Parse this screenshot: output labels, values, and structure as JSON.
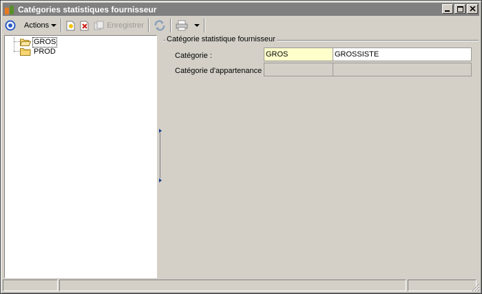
{
  "window": {
    "title": "Catégories statistiques fournisseur"
  },
  "toolbar": {
    "actions_label": "Actions",
    "save_label": "Enregistrer"
  },
  "tree": {
    "items": [
      {
        "label": "GROS",
        "selected": true,
        "open": true
      },
      {
        "label": "PROD",
        "selected": false,
        "open": false
      }
    ]
  },
  "form": {
    "group_title": "Catégorie statistique fournisseur",
    "categorie_label": "Catégorie :",
    "categorie_code": "GROS",
    "categorie_desc": "GROSSISTE",
    "appartenance_label": "Catégorie d'appartenance :",
    "appartenance_code": "",
    "appartenance_desc": ""
  },
  "colors": {
    "code_field_bg": "#ffffcc",
    "window_bg": "#d4d0c8",
    "titlebar_bg": "#808080"
  }
}
